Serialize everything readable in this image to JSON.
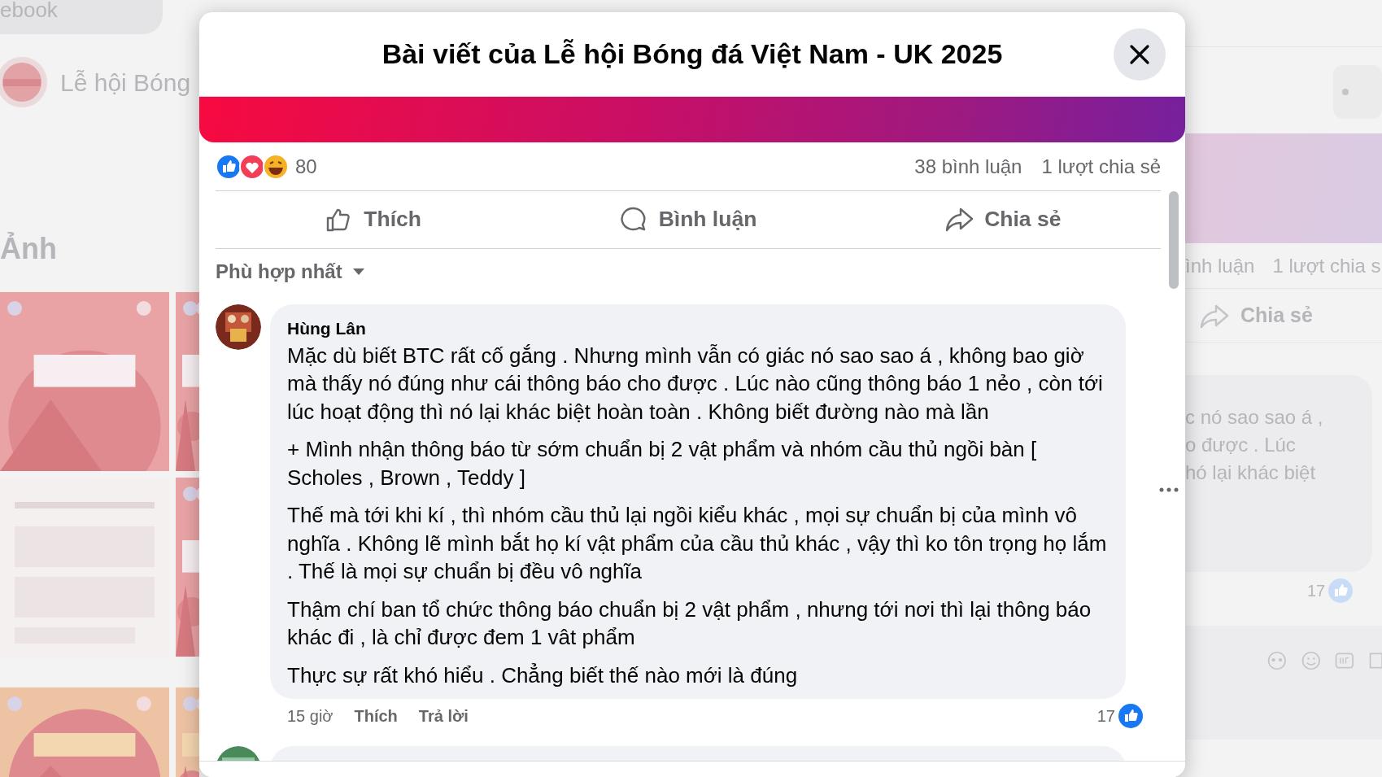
{
  "background": {
    "search_text": "ebook",
    "page_name": "Lễ hội Bóng",
    "section_title": "Ảnh",
    "photos": [
      {
        "kind": "poster"
      },
      {
        "kind": "poster"
      },
      {
        "kind": "document"
      },
      {
        "kind": "poster"
      },
      {
        "kind": "poster"
      },
      {
        "kind": "poster"
      }
    ],
    "side_post": {
      "stats": [
        "ình luận",
        "1 lượt chia s"
      ],
      "share_label": "Chia sẻ",
      "comment_lines": [
        "c nó sao sao á ,",
        "o được . Lúc",
        "hó lại khác biệt"
      ],
      "like_count": "17"
    }
  },
  "dialog": {
    "title": "Bài viết của Lễ hội Bóng đá Việt Nam - UK 2025",
    "reaction_count": "80",
    "comment_count": "38 bình luận",
    "share_count": "1 lượt chia sẻ",
    "actions": [
      {
        "kind": "like",
        "label": "Thích"
      },
      {
        "kind": "comment",
        "label": "Bình luận"
      },
      {
        "kind": "share",
        "label": "Chia sẻ"
      }
    ],
    "sort": "Phù hợp nhất",
    "comments": [
      {
        "author": "Hùng Lân",
        "paragraphs": [
          "Mặc dù biết BTC rất cố gắng . Nhưng mình vẫn có giác nó sao sao á , không bao giờ mà thấy nó đúng như cái thông báo cho được . Lúc nào cũng thông báo 1 nẻo , còn tới lúc hoạt động thì nó lại khác biệt hoàn toàn . Không biết đường nào mà lần",
          "+ Mình nhận thông báo từ sớm chuẩn bị 2 vật phẩm và nhóm cầu thủ ngồi bàn [ Scholes , Brown , Teddy ]",
          "Thế mà tới khi kí , thì nhóm cầu thủ lại ngồi kiểu khác , mọi sự chuẩn bị của mình vô nghĩa . Không lẽ mình bắt họ kí vật phẩm của cầu thủ khác , vậy thì ko tôn trọng họ lắm . Thế là mọi sự chuẩn bị đều vô nghĩa",
          "Thậm chí ban tổ chức thông báo chuẩn bị 2 vật phẩm , nhưng tới nơi thì lại thông báo khác đi , là chỉ được đem 1 vât phẩm",
          "Thực sự rất khó hiểu . Chẳng biết thế nào mới là đúng"
        ],
        "time": "15 giờ",
        "like_label": "Thích",
        "reply_label": "Trả lời",
        "like_count": "17"
      }
    ]
  }
}
